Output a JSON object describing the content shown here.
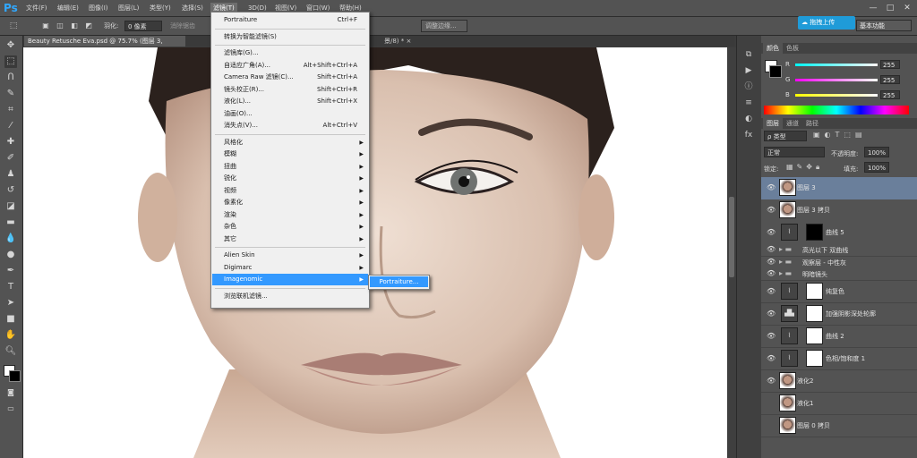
{
  "app": {
    "logo": "Ps"
  },
  "menubar": {
    "items": [
      "文件(F)",
      "编辑(E)",
      "图像(I)",
      "图层(L)",
      "类型(Y)",
      "选择(S)",
      "滤镜(T)",
      "3D(D)",
      "视图(V)",
      "窗口(W)",
      "帮助(H)"
    ],
    "active_index": 6,
    "window_controls": [
      "—",
      "□",
      "✕"
    ]
  },
  "options": {
    "feather_label": "羽化:",
    "feather_value": "0 像素",
    "antialias_label": "消除锯齿",
    "adjust_edge": "调整边缘...",
    "upload_button": "拖拽上传",
    "workspace": "基本功能"
  },
  "tabs": [
    {
      "label": "Beauty Retusche Eva.psd @ 75.7% (图层 3, RGB/8) * ×",
      "active": true
    },
    {
      "label": "景/8) * ×",
      "active": false
    }
  ],
  "filter_menu": {
    "items": [
      {
        "label": "Portraiture",
        "shortcut": "Ctrl+F"
      },
      {
        "sep": true
      },
      {
        "label": "转换为智能滤镜(S)"
      },
      {
        "sep": true
      },
      {
        "label": "滤镜库(G)..."
      },
      {
        "label": "自适应广角(A)...",
        "shortcut": "Alt+Shift+Ctrl+A"
      },
      {
        "label": "Camera Raw 滤镜(C)...",
        "shortcut": "Shift+Ctrl+A"
      },
      {
        "label": "镜头校正(R)...",
        "shortcut": "Shift+Ctrl+R"
      },
      {
        "label": "液化(L)...",
        "shortcut": "Shift+Ctrl+X"
      },
      {
        "label": "油画(O)..."
      },
      {
        "label": "消失点(V)...",
        "shortcut": "Alt+Ctrl+V"
      },
      {
        "sep": true
      },
      {
        "label": "风格化",
        "submenu": true
      },
      {
        "label": "模糊",
        "submenu": true
      },
      {
        "label": "扭曲",
        "submenu": true
      },
      {
        "label": "锐化",
        "submenu": true
      },
      {
        "label": "视频",
        "submenu": true
      },
      {
        "label": "像素化",
        "submenu": true
      },
      {
        "label": "渲染",
        "submenu": true
      },
      {
        "label": "杂色",
        "submenu": true
      },
      {
        "label": "其它",
        "submenu": true
      },
      {
        "sep": true
      },
      {
        "label": "Alien Skin",
        "submenu": true
      },
      {
        "label": "Digimarc",
        "submenu": true
      },
      {
        "label": "Imagenomic",
        "submenu": true,
        "highlighted": true
      },
      {
        "sep": true
      },
      {
        "label": "浏览联机滤镜..."
      }
    ],
    "submenu_item": "Portraiture..."
  },
  "color_panel": {
    "tabs": [
      "颜色",
      "色板"
    ],
    "channels": [
      {
        "label": "R",
        "value": "255",
        "gradient": "linear-gradient(90deg,#00ffff,#ffffff)"
      },
      {
        "label": "G",
        "value": "255",
        "gradient": "linear-gradient(90deg,#ff00ff,#ffffff)"
      },
      {
        "label": "B",
        "value": "255",
        "gradient": "linear-gradient(90deg,#ffff00,#ffffff)"
      }
    ]
  },
  "layers_panel": {
    "tabs": [
      "图层",
      "通道",
      "路径"
    ],
    "filter_kind": "ρ 类型",
    "blend_mode": "正常",
    "opacity_label": "不透明度:",
    "opacity_value": "100%",
    "lock_label": "锁定:",
    "fill_label": "填充:",
    "fill_value": "100%",
    "layers": [
      {
        "name": "图层 3",
        "type": "photo",
        "selected": true,
        "visible": true
      },
      {
        "name": "图层 3 拷贝",
        "type": "photo",
        "visible": true
      },
      {
        "name": "曲线 5",
        "type": "adjust-mask-black",
        "visible": true
      },
      {
        "name": "高光以下 双曲线",
        "type": "group",
        "visible": true
      },
      {
        "name": "观察层 - 中性灰",
        "type": "group",
        "visible": true
      },
      {
        "name": "明暗镜头",
        "type": "group",
        "visible": true
      },
      {
        "name": "纯复色",
        "type": "adjust",
        "visible": true
      },
      {
        "name": "加强阴影深处轮廓",
        "type": "adjust-levels",
        "visible": true
      },
      {
        "name": "曲线 2",
        "type": "adjust",
        "visible": true
      },
      {
        "name": "色相/饱和度 1",
        "type": "adjust-mask-white",
        "visible": true
      },
      {
        "name": "液化2",
        "type": "photo",
        "visible": true
      },
      {
        "name": "液化1",
        "type": "photo",
        "visible": false
      },
      {
        "name": "图层 0 拷贝",
        "type": "photo",
        "visible": false
      }
    ]
  },
  "colors": {
    "accent": "#3399ff",
    "selected_layer": "#6a7f9b",
    "upload": "#1f9bd8"
  }
}
